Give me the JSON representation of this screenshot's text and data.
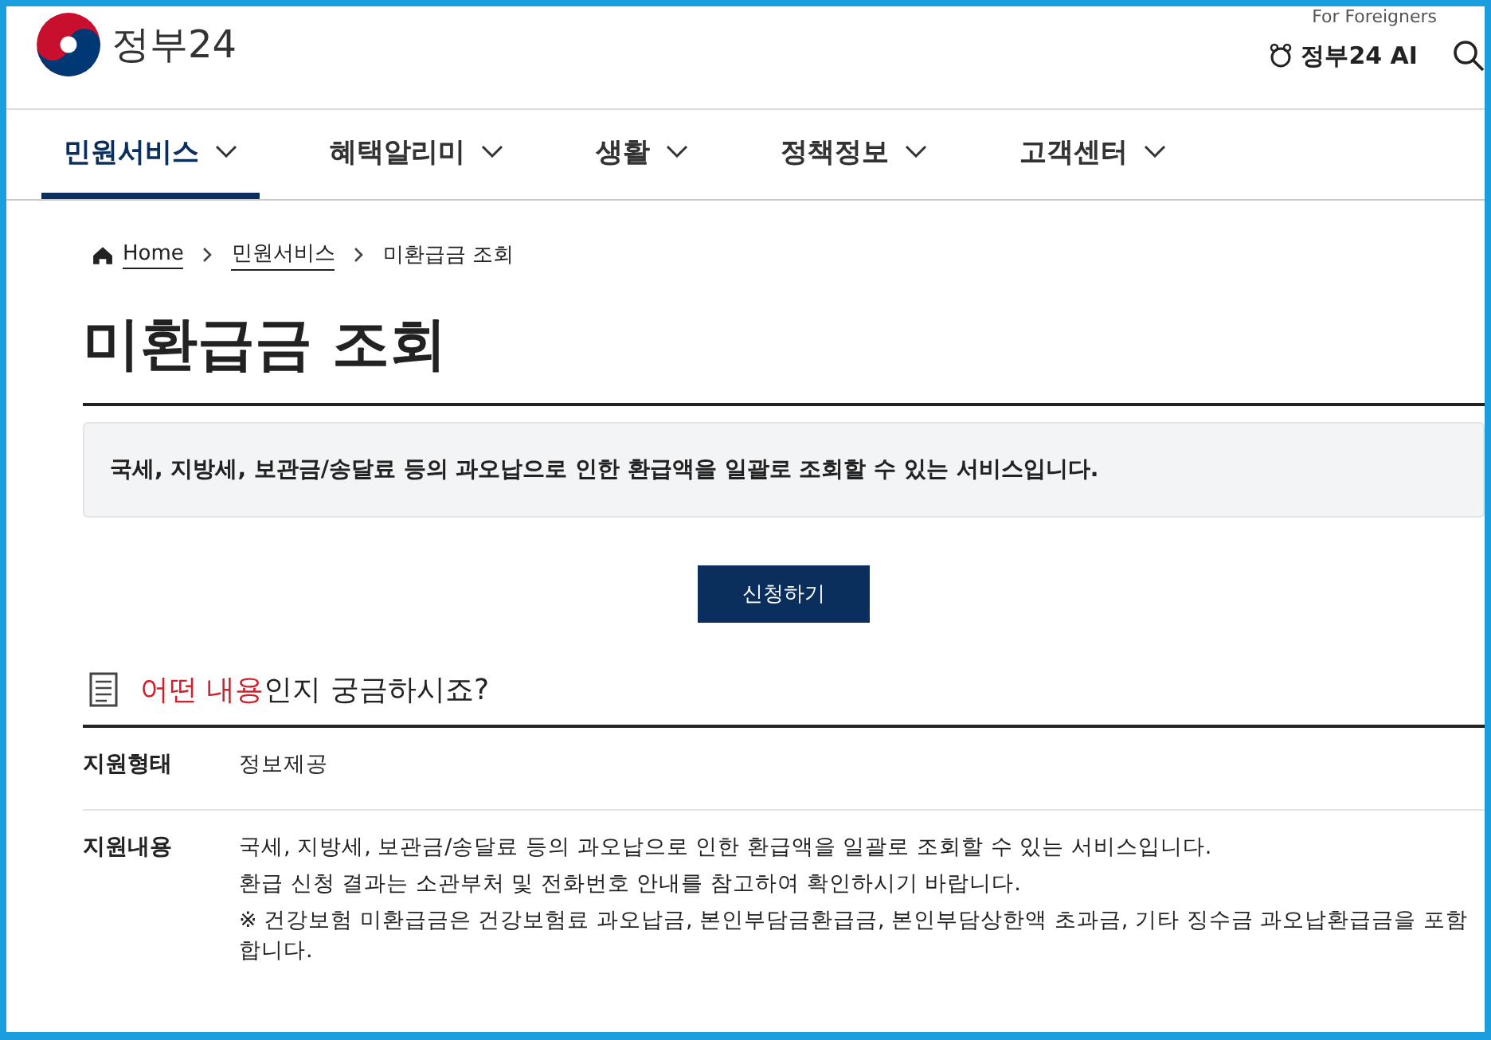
{
  "header": {
    "logo_text": "정부24",
    "top_link": "For Foreigners",
    "ai_label": "정부24 AI"
  },
  "nav": [
    {
      "label": "민원서비스",
      "selected": true
    },
    {
      "label": "혜택알리미",
      "selected": false
    },
    {
      "label": "생활",
      "selected": false
    },
    {
      "label": "정책정보",
      "selected": false
    },
    {
      "label": "고객센터",
      "selected": false
    }
  ],
  "breadcrumb": [
    "Home",
    "민원서비스",
    "미환급금 조회"
  ],
  "title": "미환급금 조회",
  "summary": "국세, 지방세, 보관금/송달료 등의 과오납으로 인한 환급액을 일괄로 조회할 수 있는 서비스입니다.",
  "apply_button": "신청하기",
  "section": {
    "highlight": "어떤 내용",
    "rest": "인지 궁금하시죠?"
  },
  "rows": [
    {
      "label": "지원형태",
      "lines": [
        "정보제공"
      ]
    },
    {
      "label": "지원내용",
      "lines": [
        "국세, 지방세, 보관금/송달료 등의 과오납으로 인한 환급액을 일괄로 조회할 수 있는 서비스입니다.",
        "환급 신청 결과는 소관부처 및 전화번호 안내를 참고하여 확인하시기 바랍니다.",
        "※ 건강보험 미환급금은 건강보험료 과오납금, 본인부담금환급금, 본인부담상한액 초과금, 기타 징수금 과오납환급금을 포함합니다."
      ]
    }
  ]
}
